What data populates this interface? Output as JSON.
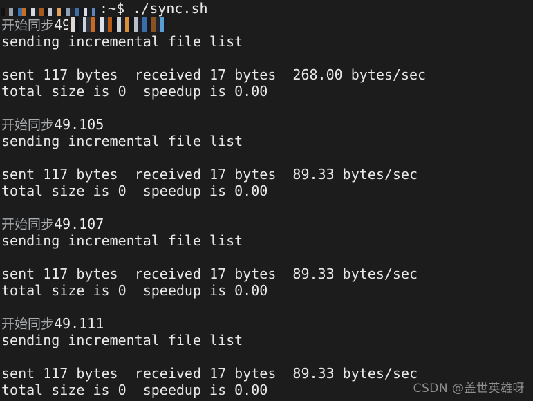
{
  "terminal": {
    "background_color": "#1c1c1c",
    "text_color": "#e8e8e8",
    "dim_text_color": "#a9acb0",
    "prompt": {
      "user_host_redacted": true,
      "tail": ":~$ ",
      "command": "./sync.sh"
    },
    "blocks": [
      {
        "start_label": "开始同步",
        "start_value": "49.171",
        "file_list": "sending incremental file list",
        "transfer": "sent 117 bytes  received 17 bytes  268.00 bytes/sec",
        "totals": "total size is 0  speedup is 0.00"
      },
      {
        "start_label": "开始同步",
        "start_value": "49.105",
        "file_list": "sending incremental file list",
        "transfer": "sent 117 bytes  received 17 bytes  89.33 bytes/sec",
        "totals": "total size is 0  speedup is 0.00"
      },
      {
        "start_label": "开始同步",
        "start_value": "49.107",
        "file_list": "sending incremental file list",
        "transfer": "sent 117 bytes  received 17 bytes  89.33 bytes/sec",
        "totals": "total size is 0  speedup is 0.00"
      },
      {
        "start_label": "开始同步",
        "start_value": "49.111",
        "file_list": "sending incremental file list",
        "transfer": "sent 117 bytes  received 17 bytes  89.33 bytes/sec",
        "totals": "total size is 0  speedup is 0.00"
      }
    ]
  },
  "watermark": {
    "text": "CSDN @盖世英雄呀",
    "color": "#9a9a9a"
  }
}
